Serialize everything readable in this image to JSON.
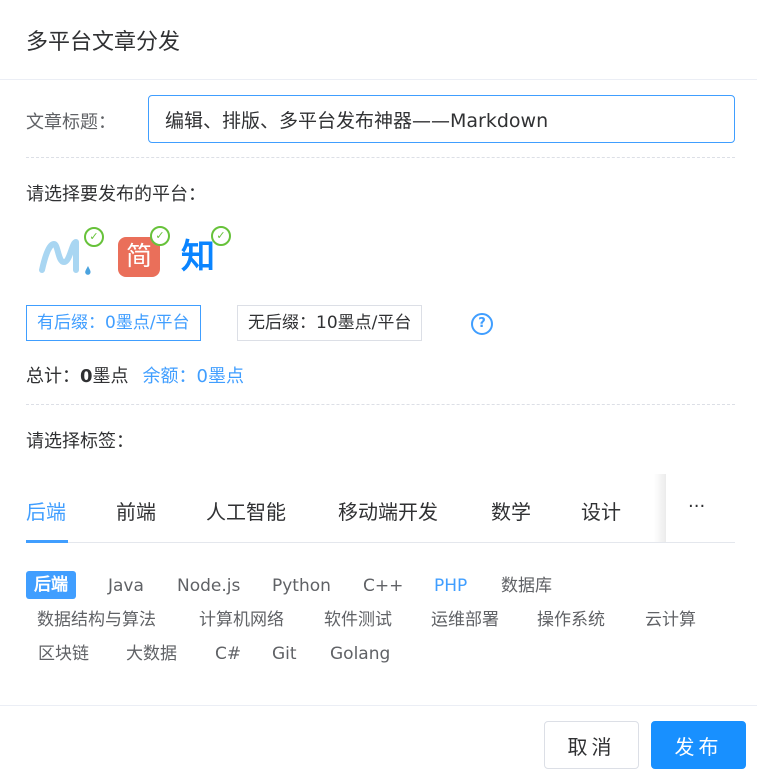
{
  "dialog": {
    "title": "多平台文章分发"
  },
  "article": {
    "label": "文章标题：",
    "value": "编辑、排版、多平台发布神器——Markdown"
  },
  "platforms": {
    "label": "请选择要发布的平台：",
    "items": [
      {
        "name": "mdnice",
        "checked": true
      },
      {
        "name": "jianshu",
        "glyph": "简",
        "checked": true
      },
      {
        "name": "zhihu",
        "glyph": "知",
        "checked": true
      }
    ],
    "check_glyph": "✓"
  },
  "pricing": {
    "with_suffix": "有后缀：0墨点/平台",
    "without_suffix": "无后缀：10墨点/平台",
    "help_glyph": "?"
  },
  "total": {
    "label": "总计：",
    "amount": "0",
    "unit": "墨点",
    "balance": "余额：0墨点"
  },
  "tags": {
    "label": "请选择标签：",
    "tabs": [
      "后端",
      "前端",
      "人工智能",
      "移动端开发",
      "数学",
      "设计"
    ],
    "more": "···",
    "items": [
      "后端",
      "Java",
      "Node.js",
      "Python",
      "C++",
      "PHP",
      "数据库",
      "数据结构与算法",
      "计算机网络",
      "软件测试",
      "运维部署",
      "操作系统",
      "云计算",
      "区块链",
      "大数据",
      "C#",
      "Git",
      "Golang"
    ]
  },
  "footer": {
    "cancel": "取消",
    "publish": "发布"
  },
  "colors": {
    "accent": "#409eff",
    "check": "#67c23a",
    "jianshu": "#ea6f5a",
    "zhihu": "#0a84ff"
  }
}
